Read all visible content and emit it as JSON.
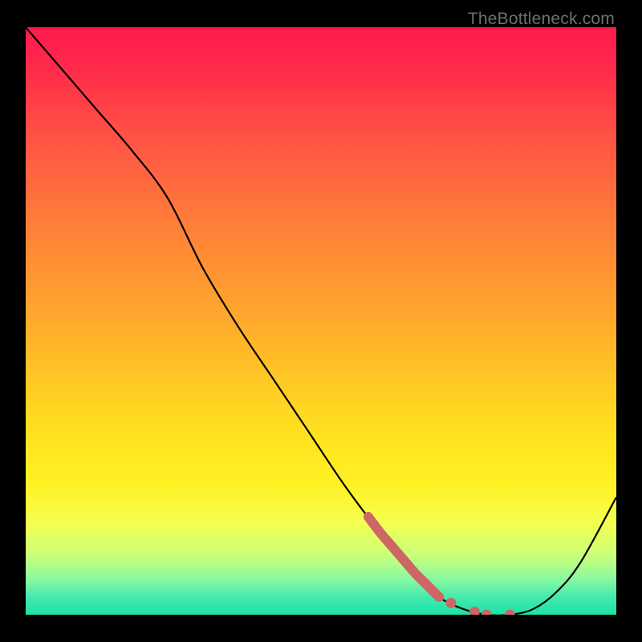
{
  "watermark": "TheBottleneck.com",
  "chart_data": {
    "type": "line",
    "title": "",
    "xlabel": "",
    "ylabel": "",
    "xlim": [
      0,
      100
    ],
    "ylim": [
      0,
      100
    ],
    "grid": false,
    "legend": false,
    "series": [
      {
        "name": "bottleneck-curve",
        "x": [
          0,
          6,
          12,
          18,
          24,
          30,
          36,
          42,
          48,
          54,
          60,
          66,
          70,
          74,
          78,
          82,
          86,
          90,
          94,
          100
        ],
        "y": [
          100,
          93,
          86,
          79,
          71,
          59,
          49,
          40,
          31,
          22,
          14,
          7,
          3,
          1,
          0,
          0,
          1,
          4,
          9,
          20
        ]
      }
    ],
    "highlight": {
      "name": "selected-range",
      "x_range": [
        58,
        82
      ],
      "points_x": [
        72,
        76,
        78,
        82
      ]
    },
    "background_gradient": [
      "#ff1a4e",
      "#ff4a46",
      "#ff8a35",
      "#ffc824",
      "#fff225",
      "#c8ff7a",
      "#1de2a8"
    ]
  }
}
